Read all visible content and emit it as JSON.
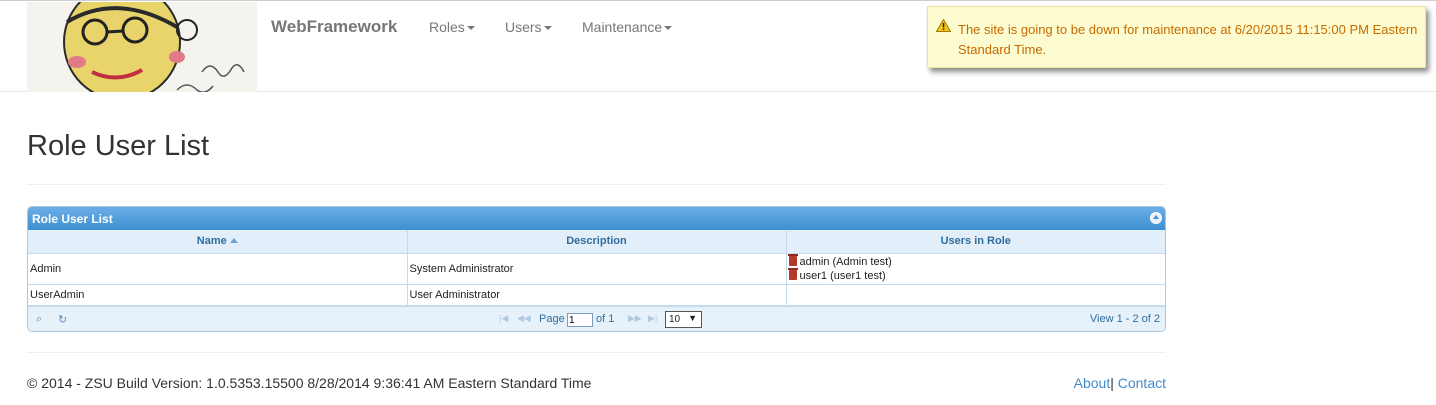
{
  "navbar": {
    "brand": "WebFramework",
    "items": [
      {
        "label": "Roles"
      },
      {
        "label": "Users"
      },
      {
        "label": "Maintenance"
      }
    ]
  },
  "alert": {
    "message": "The site is going to be down for maintenance at 6/20/2015 11:15:00 PM Eastern Standard Time."
  },
  "page": {
    "title": "Role User List"
  },
  "grid": {
    "caption": "Role User List",
    "columns": [
      "Name",
      "Description",
      "Users in Role"
    ],
    "rows": [
      {
        "name": "Admin",
        "description": "System Administrator",
        "users": [
          "admin (Admin test)",
          "user1 (user1 test)"
        ]
      },
      {
        "name": "UserAdmin",
        "description": "User Administrator",
        "users": []
      }
    ],
    "pager": {
      "page_label": "Page",
      "page_value": "1",
      "of_label": "of 1",
      "rows_per_page": "10",
      "view_text": "View 1 - 2 of 2"
    }
  },
  "footer": {
    "text": "© 2014 - ZSU Build Version: 1.0.5353.15500 8/28/2014 9:36:41 AM Eastern Standard Time",
    "about": "About",
    "separator": "|",
    "contact": "Contact"
  },
  "colors": {
    "alert_text": "#c76a00",
    "grid_header": "#3f8fd2",
    "link": "#428bca"
  }
}
